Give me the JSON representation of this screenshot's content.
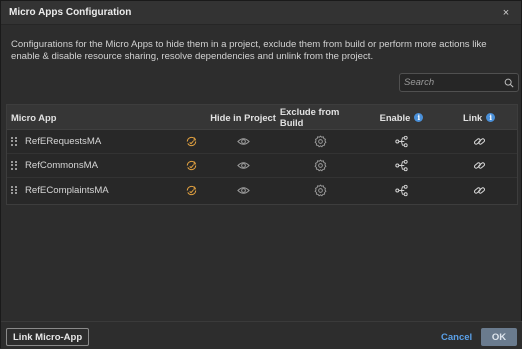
{
  "dialog": {
    "title": "Micro Apps Configuration",
    "close_glyph": "×",
    "description": "Configurations for the Micro Apps to hide them in a project, exclude them from build or perform more actions like enable & disable resource sharing, resolve dependencies and unlink from the project."
  },
  "search": {
    "placeholder": "Search",
    "value": "",
    "icon": "search-icon"
  },
  "table": {
    "headers": {
      "micro_app": "Micro App",
      "hide": "Hide in Project",
      "exclude": "Exclude from Build",
      "enable": "Enable",
      "link": "Link"
    },
    "info_glyph": "i",
    "rows": [
      {
        "name": "RefERequestsMA",
        "status_icon": "sync-status-icon",
        "hide_icon": "eye-icon",
        "exclude_icon": "gear-icon",
        "enable_icon": "share-nodes-icon",
        "link_icon": "link-icon"
      },
      {
        "name": "RefCommonsMA",
        "status_icon": "sync-status-icon",
        "hide_icon": "eye-icon",
        "exclude_icon": "gear-icon",
        "enable_icon": "share-nodes-icon",
        "link_icon": "link-icon"
      },
      {
        "name": "RefEComplaintsMA",
        "status_icon": "sync-status-icon",
        "hide_icon": "eye-icon",
        "exclude_icon": "gear-icon",
        "enable_icon": "share-nodes-icon",
        "link_icon": "link-icon"
      }
    ]
  },
  "footer": {
    "link_button": "Link Micro-App",
    "cancel_button": "Cancel",
    "ok_button": "OK"
  },
  "colors": {
    "accent": "#5aa0e8",
    "status_icon": "#e0a040",
    "ok_button_bg": "#6a7b8e"
  }
}
